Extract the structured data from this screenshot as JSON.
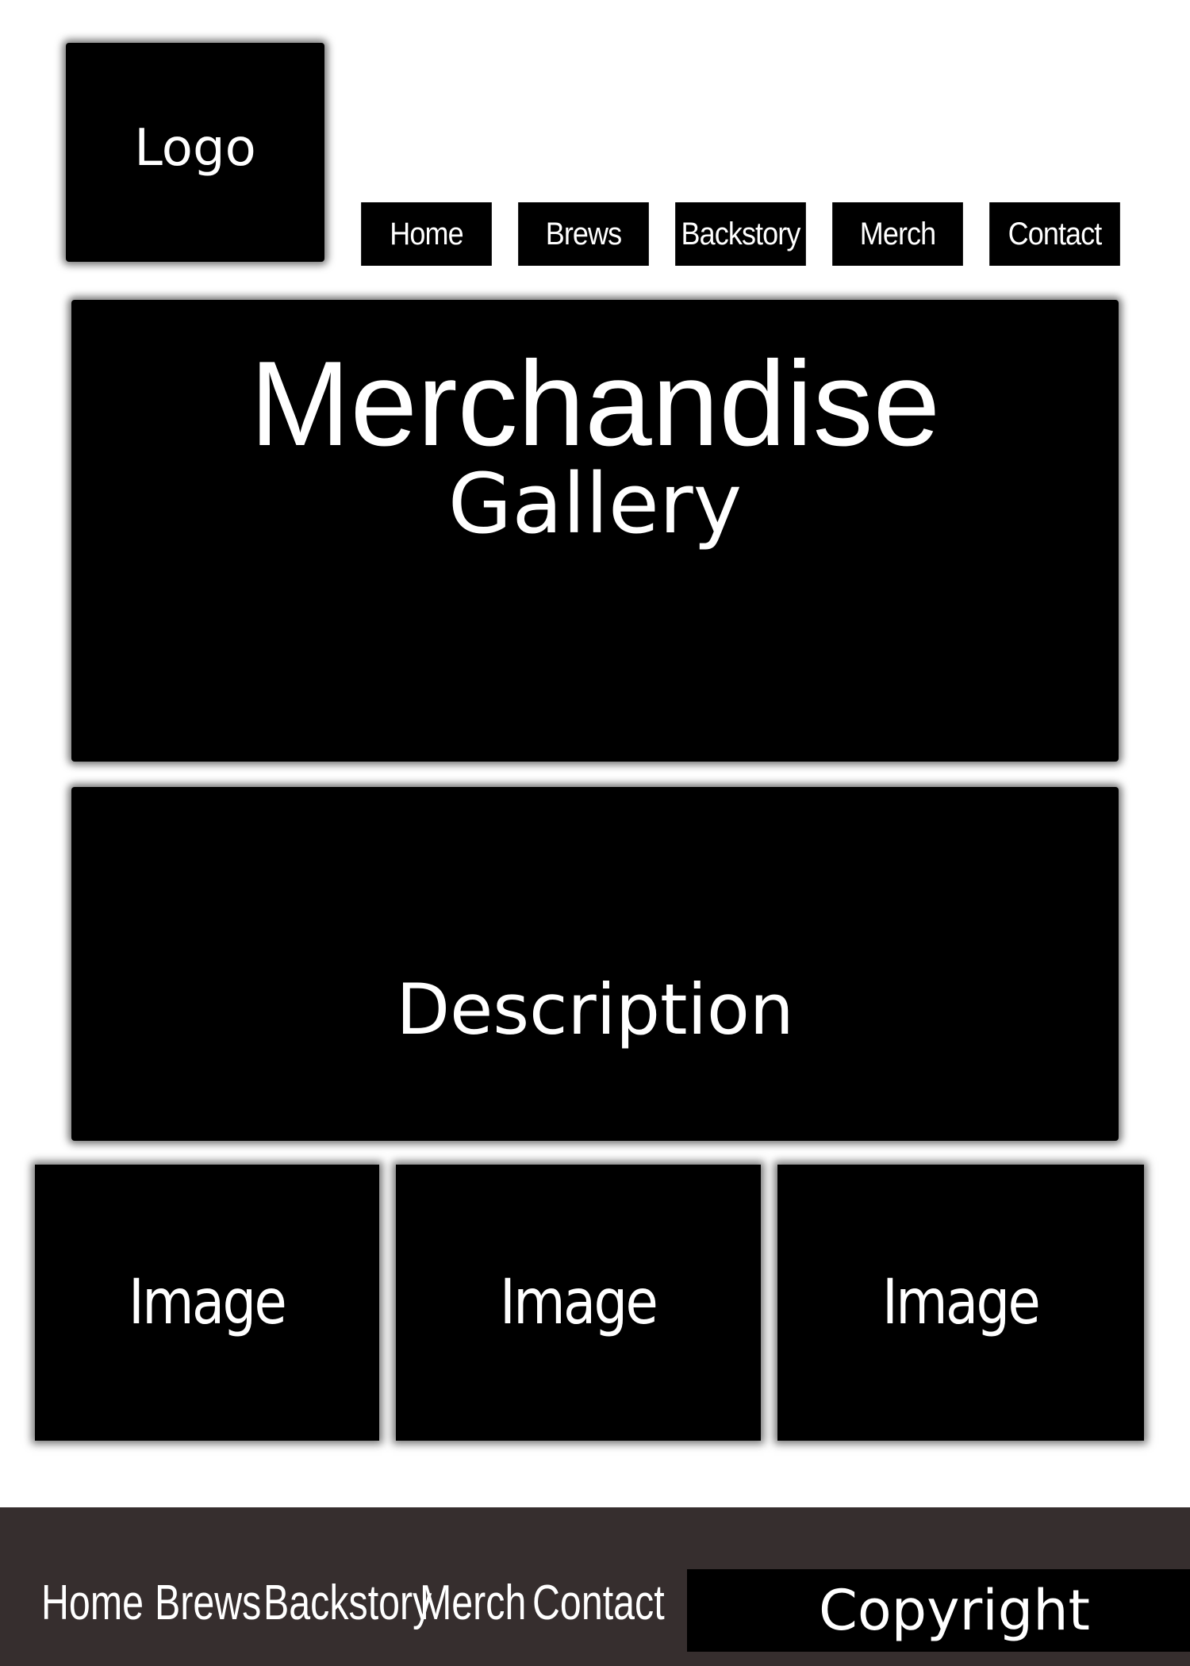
{
  "header": {
    "logo_label": "Logo",
    "nav": {
      "home": "Home",
      "brews": "Brews",
      "backstory": "Backstory",
      "merch": "Merch",
      "contact": "Contact"
    }
  },
  "hero": {
    "title": "Merchandise",
    "subtitle": "Gallery"
  },
  "description": {
    "label": "Description"
  },
  "gallery": {
    "images": [
      {
        "label": "Image"
      },
      {
        "label": "Image"
      },
      {
        "label": "Image"
      }
    ]
  },
  "footer": {
    "nav": {
      "home": "Home",
      "brews": "Brews",
      "backstory": "Backstory",
      "merch": "Merch",
      "contact": "Contact"
    },
    "copyright": "Copyright"
  },
  "colors": {
    "block": "#000000",
    "footer_bg": "#362e2e",
    "text": "#ffffff",
    "page_bg": "#ffffff"
  }
}
